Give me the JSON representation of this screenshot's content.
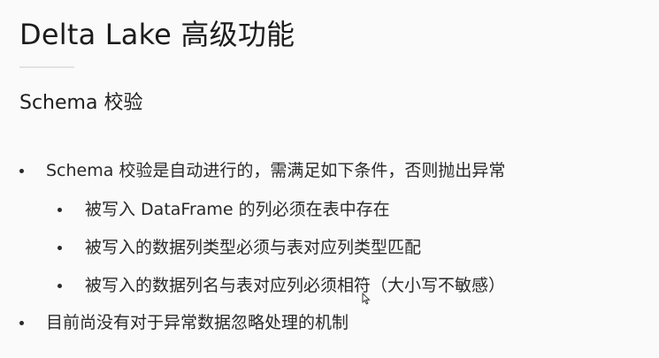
{
  "slide": {
    "title": "Delta Lake 高级功能",
    "subtitle": "Schema 校验",
    "bullets": [
      {
        "text": "Schema 校验是自动进行的，需满足如下条件，否则抛出异常",
        "level": 1
      },
      {
        "text": "被写入 DataFrame 的列必须在表中存在",
        "level": 2
      },
      {
        "text": "被写入的数据列类型必须与表对应列类型匹配",
        "level": 2
      },
      {
        "text": "被写入的数据列名与表对应列必须相符（大小写不敏感）",
        "level": 2
      },
      {
        "text": "目前尚没有对于异常数据忽略处理的机制",
        "level": 1
      }
    ]
  },
  "icons": {
    "cursor": "mouse-pointer-icon"
  },
  "colors": {
    "background": "#fafafa",
    "text": "#222222",
    "divider": "#e2e2e2"
  }
}
